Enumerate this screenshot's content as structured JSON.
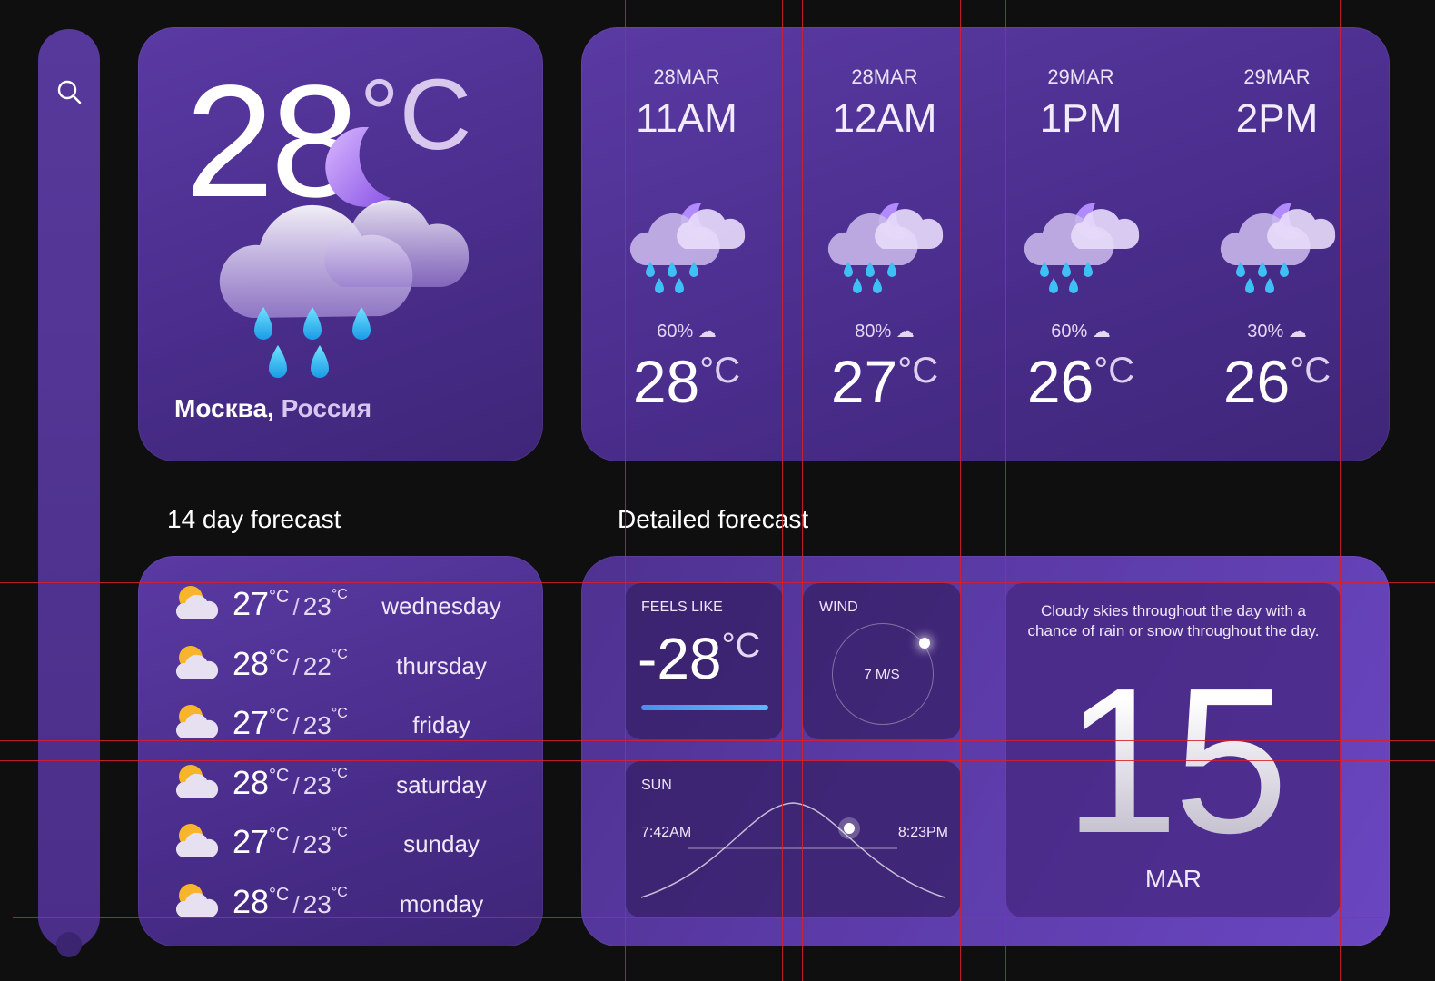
{
  "current": {
    "temp": "28",
    "unit": "°C",
    "city": "Москва,",
    "country": "Россия"
  },
  "hourly": [
    {
      "date": "28MAR",
      "time": "11AM",
      "precip": "60%",
      "temp": "28",
      "unit": "°C"
    },
    {
      "date": "28MAR",
      "time": "12AM",
      "precip": "80%",
      "temp": "27",
      "unit": "°C"
    },
    {
      "date": "29MAR",
      "time": "1PM",
      "precip": "60%",
      "temp": "26",
      "unit": "°C"
    },
    {
      "date": "29MAR",
      "time": "2PM",
      "precip": "30%",
      "temp": "26",
      "unit": "°C"
    }
  ],
  "sections": {
    "daily_title": "14 day forecast",
    "detailed_title": "Detailed forecast"
  },
  "daily": [
    {
      "high": "27",
      "low": "23",
      "unit": "°C",
      "day": "wednesday"
    },
    {
      "high": "28",
      "low": "22",
      "unit": "°C",
      "day": "thursday"
    },
    {
      "high": "27",
      "low": "23",
      "unit": "°C",
      "day": "friday"
    },
    {
      "high": "28",
      "low": "23",
      "unit": "°C",
      "day": "saturday"
    },
    {
      "high": "27",
      "low": "23",
      "unit": "°C",
      "day": "sunday"
    },
    {
      "high": "28",
      "low": "23",
      "unit": "°C",
      "day": "monday"
    }
  ],
  "details": {
    "feels_label": "FEELS LIKE",
    "feels_value": "-28",
    "feels_unit": "°C",
    "wind_label": "WIND",
    "wind_value": "7 M/S",
    "sun_label": "SUN",
    "sunrise": "7:42AM",
    "sunset": "8:23PM",
    "summary": "Cloudy skies throughout the day with a chance of rain or snow throughout the day.",
    "day": "15",
    "month": "MAR"
  },
  "icons": {
    "sidebar_search": "search-icon",
    "weather": "cloud-moon-rain-icon",
    "daily": "sun-cloud-icon",
    "precip": "cloud-rain-icon"
  },
  "colors": {
    "background": "#0f0f10",
    "panel": "#5a3aa3",
    "accent_blue": "#4a8ff0"
  }
}
